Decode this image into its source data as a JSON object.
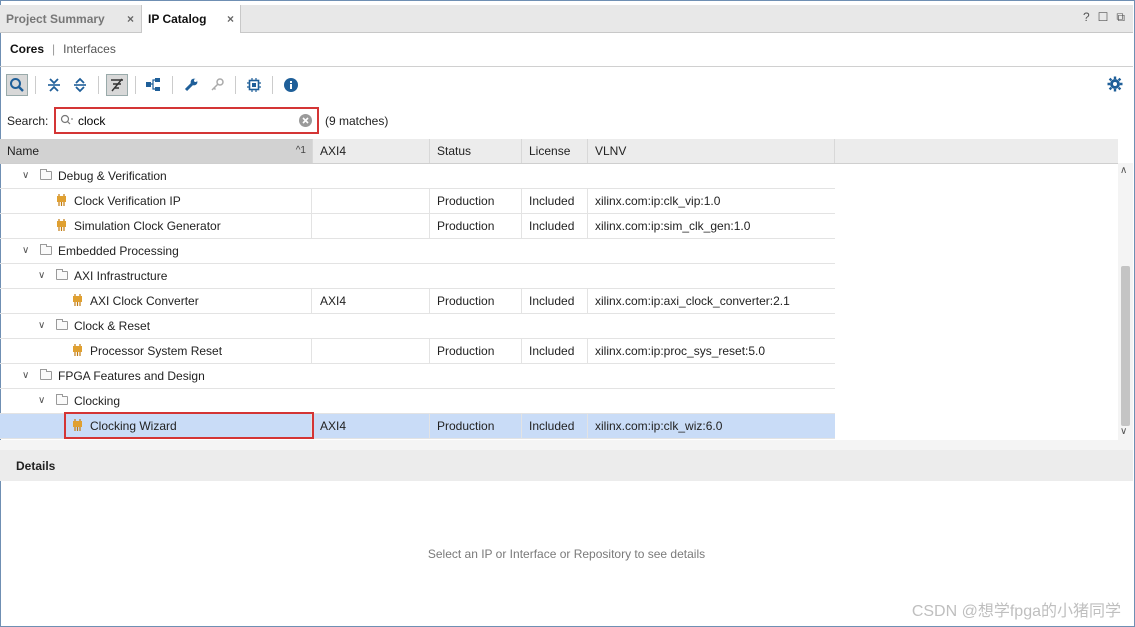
{
  "tabs": [
    {
      "label": "Project Summary",
      "close": "×"
    },
    {
      "label": "IP Catalog",
      "close": "×"
    }
  ],
  "window_icons": [
    "?",
    "☐",
    "⧉"
  ],
  "subtabs": {
    "cores": "Cores",
    "sep": "|",
    "interfaces": "Interfaces"
  },
  "toolbar_icons": [
    "search-icon",
    "collapse-all-icon",
    "expand-all-icon",
    "filter-icon",
    "hierarchy-icon",
    "wrench-icon",
    "key-icon",
    "chip-icon",
    "info-icon"
  ],
  "search": {
    "label": "Search:",
    "value": "clock",
    "matches": "(9 matches)"
  },
  "columns": [
    "Name",
    "AXI4",
    "Status",
    "License",
    "VLNV"
  ],
  "sort_mark": "^1",
  "rows": [
    {
      "name": "Debug & Verification",
      "axi4": "",
      "status": "",
      "license": "",
      "vlnv": ""
    },
    {
      "name": "Clock Verification IP",
      "axi4": "",
      "status": "Production",
      "license": "Included",
      "vlnv": "xilinx.com:ip:clk_vip:1.0"
    },
    {
      "name": "Simulation Clock Generator",
      "axi4": "",
      "status": "Production",
      "license": "Included",
      "vlnv": "xilinx.com:ip:sim_clk_gen:1.0"
    },
    {
      "name": "Embedded Processing",
      "axi4": "",
      "status": "",
      "license": "",
      "vlnv": ""
    },
    {
      "name": "AXI Infrastructure",
      "axi4": "",
      "status": "",
      "license": "",
      "vlnv": ""
    },
    {
      "name": "AXI Clock Converter",
      "axi4": "AXI4",
      "status": "Production",
      "license": "Included",
      "vlnv": "xilinx.com:ip:axi_clock_converter:2.1"
    },
    {
      "name": "Clock & Reset",
      "axi4": "",
      "status": "",
      "license": "",
      "vlnv": ""
    },
    {
      "name": "Processor System Reset",
      "axi4": "",
      "status": "Production",
      "license": "Included",
      "vlnv": "xilinx.com:ip:proc_sys_reset:5.0"
    },
    {
      "name": "FPGA Features and Design",
      "axi4": "",
      "status": "",
      "license": "",
      "vlnv": ""
    },
    {
      "name": "Clocking",
      "axi4": "",
      "status": "",
      "license": "",
      "vlnv": ""
    },
    {
      "name": "Clocking Wizard",
      "axi4": "AXI4",
      "status": "Production",
      "license": "Included",
      "vlnv": "xilinx.com:ip:clk_wiz:6.0"
    }
  ],
  "details": {
    "title": "Details",
    "message": "Select an IP or Interface or Repository to see details"
  },
  "watermark": "CSDN @想学fpga的小猪同学",
  "colors": {
    "selection": "#c9dcf7",
    "highlight_box": "#d43535",
    "ip_icon": "#e0a030"
  }
}
